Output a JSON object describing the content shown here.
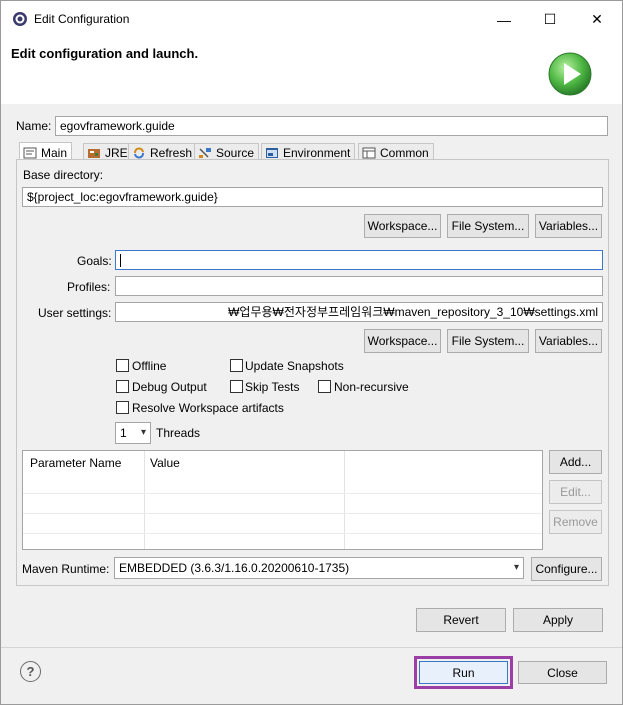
{
  "window": {
    "title": "Edit Configuration",
    "minimize_glyph": "—",
    "maximize_glyph": "☐",
    "close_glyph": "✕"
  },
  "header": {
    "title": "Edit configuration and launch."
  },
  "name_row": {
    "label": "Name:",
    "value": "egovframework.guide"
  },
  "tabs": [
    {
      "label": "Main",
      "icon": "main-tab-icon"
    },
    {
      "label": "JRE",
      "icon": "jre-icon"
    },
    {
      "label": "Refresh",
      "icon": "refresh-icon"
    },
    {
      "label": "Source",
      "icon": "source-icon"
    },
    {
      "label": "Environment",
      "icon": "environment-icon"
    },
    {
      "label": "Common",
      "icon": "common-icon"
    }
  ],
  "main": {
    "base_dir_label": "Base directory:",
    "base_dir_value": "${project_loc:egovframework.guide}",
    "workspace_btn": "Workspace...",
    "filesystem_btn": "File System...",
    "variables_btn": "Variables...",
    "goals_label": "Goals:",
    "goals_value": "",
    "profiles_label": "Profiles:",
    "profiles_value": "",
    "user_settings_label": "User settings:",
    "user_settings_value": "₩업무용₩전자정부프레임워크₩maven_repository_3_10₩settings.xml",
    "workspace_btn2": "Workspace...",
    "filesystem_btn2": "File System...",
    "variables_btn2": "Variables...",
    "offline": "Offline",
    "update_snapshots": "Update Snapshots",
    "debug_output": "Debug Output",
    "skip_tests": "Skip Tests",
    "non_recursive": "Non-recursive",
    "resolve_workspace": "Resolve Workspace artifacts",
    "threads_value": "1",
    "threads_label": "Threads",
    "param_col_name": "Parameter Name",
    "param_col_value": "Value",
    "add_btn": "Add...",
    "edit_btn": "Edit...",
    "remove_btn": "Remove",
    "maven_runtime_label": "Maven Runtime:",
    "maven_runtime_value": "EMBEDDED (3.6.3/1.16.0.20200610-1735)",
    "configure_btn": "Configure..."
  },
  "actions": {
    "revert": "Revert",
    "apply": "Apply",
    "run": "Run",
    "close": "Close",
    "help_glyph": "?"
  },
  "colors": {
    "run_highlight": "#9b3fa6",
    "run_icon_green": "#3aa33a"
  }
}
